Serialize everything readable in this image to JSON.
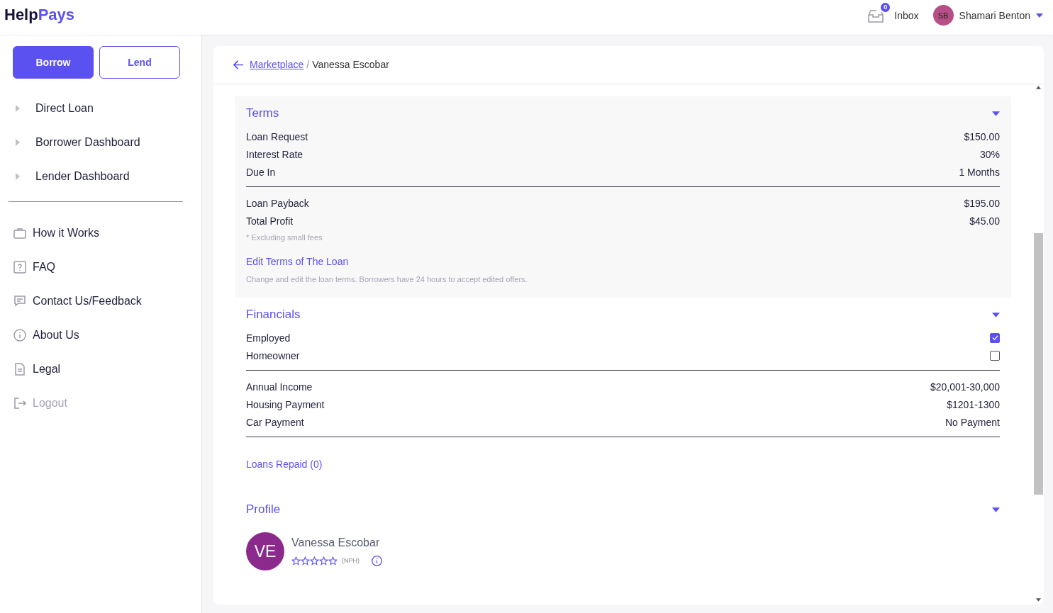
{
  "logo": {
    "first": "Help",
    "second": "Pays"
  },
  "header": {
    "inbox": {
      "label": "Inbox",
      "count": "0"
    },
    "user": {
      "initials": "SB",
      "name": "Shamari Benton"
    }
  },
  "sidebar": {
    "buttons": [
      {
        "label": "Borrow",
        "selected": true
      },
      {
        "label": "Lend",
        "selected": false
      }
    ],
    "expandable_items": [
      {
        "label": "Direct Loan",
        "expanded": false
      },
      {
        "label": "Borrower Dashboard",
        "expanded": false
      },
      {
        "label": "Lender Dashboard",
        "expanded": false
      }
    ],
    "links": [
      {
        "label": "How it Works",
        "kind": "briefcase",
        "disabled": false
      },
      {
        "label": "FAQ",
        "kind": "question",
        "disabled": false
      },
      {
        "label": "Contact Us/Feedback",
        "kind": "chat",
        "disabled": false
      },
      {
        "label": "About Us",
        "kind": "info",
        "disabled": false
      },
      {
        "label": "Legal",
        "kind": "document",
        "disabled": false
      },
      {
        "label": "Logout",
        "kind": "logout",
        "disabled": true
      }
    ]
  },
  "breadcrumb": {
    "link": "Marketplace",
    "separator": "/",
    "current": "Vanessa Escobar"
  },
  "terms": {
    "title": "Terms",
    "expanded": true,
    "rows": [
      {
        "label": "Loan Request",
        "value": "$150.00"
      },
      {
        "label": "Interest Rate",
        "value": "30%"
      },
      {
        "label": "Due In",
        "value": "1 Months"
      }
    ],
    "totals": [
      {
        "label": "Loan Payback",
        "value": "$195.00"
      },
      {
        "label": "Total Profit",
        "value": "$45.00"
      }
    ],
    "note": "* Excluding small fees",
    "edit_link": "Edit Terms of The Loan",
    "edit_help": "Change and edit the loan terms. Borrowers have 24 hours to accept edited offers."
  },
  "financials": {
    "title": "Financials",
    "expanded": true,
    "checks": [
      {
        "label": "Employed",
        "checked": true
      },
      {
        "label": "Homeowner",
        "checked": false
      }
    ],
    "rows": [
      {
        "label": "Annual Income",
        "value": "$20,001-30,000"
      },
      {
        "label": "Housing Payment",
        "value": "$1201-1300"
      },
      {
        "label": "Car Payment",
        "value": "No Payment"
      }
    ],
    "link": "Loans Repaid (0)"
  },
  "profile": {
    "title": "Profile",
    "expanded": true,
    "initials": "VE",
    "name": "Vanessa Escobar",
    "stars": 0,
    "tag": "(NPH)"
  }
}
